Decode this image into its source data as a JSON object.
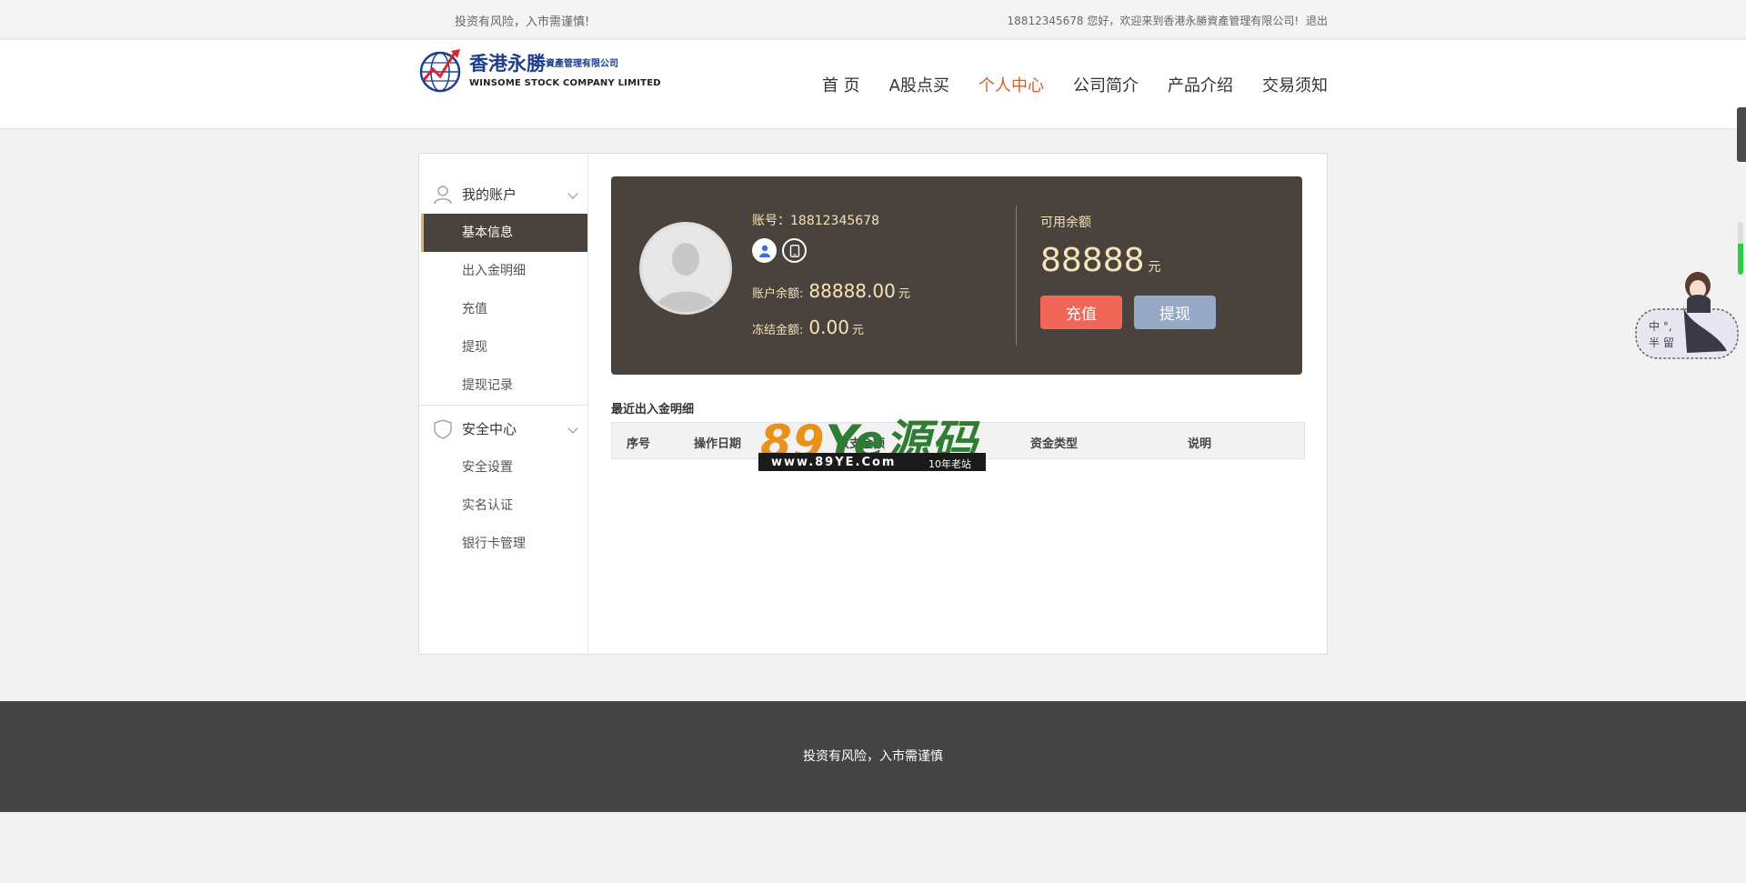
{
  "topbar": {
    "risk_text": "投资有风险，入市需谨慎!",
    "greeting": "18812345678 您好，欢迎来到香港永勝資產管理有限公司!",
    "logout": "退出"
  },
  "logo": {
    "name_cn": "香港永勝",
    "sub_cn": "資產管理有限公司",
    "name_en": "WINSOME STOCK COMPANY LIMITED",
    "icon": "globe-arrow-icon"
  },
  "nav": [
    {
      "label": "首 页",
      "active": false
    },
    {
      "label": "A股点买",
      "active": false
    },
    {
      "label": "个人中心",
      "active": true
    },
    {
      "label": "公司简介",
      "active": false
    },
    {
      "label": "产品介绍",
      "active": false
    },
    {
      "label": "交易须知",
      "active": false
    }
  ],
  "sidebar": {
    "account_section": {
      "title": "我的账户",
      "icon": "user-icon"
    },
    "account_items": [
      "基本信息",
      "出入金明细",
      "充值",
      "提现",
      "提现记录"
    ],
    "security_section": {
      "title": "安全中心",
      "icon": "shield-icon"
    },
    "security_items": [
      "安全设置",
      "实名认证",
      "银行卡管理"
    ]
  },
  "profile": {
    "account_label": "账号：",
    "account_value": "18812345678",
    "balance_label": "账户余额:",
    "balance_value": "88888.00",
    "frozen_label": "冻结金额:",
    "frozen_value": "0.00",
    "unit": "元",
    "available_label": "可用余额",
    "available_value": "88888",
    "recharge_btn": "充值",
    "withdraw_btn": "提现"
  },
  "recent": {
    "title": "最近出入金明细",
    "columns": [
      "序号",
      "操作日期",
      "收支金额",
      "资金类型",
      "说明"
    ]
  },
  "watermark": {
    "brand_num": "89",
    "brand_ye": "Ye",
    "brand_cn": "源码",
    "url": "www.89YE.Com",
    "tag": "10年老站"
  },
  "footer": {
    "text": "投资有风险，入市需谨慎"
  },
  "float_widget": {
    "text": "中 °, 半 留"
  },
  "colors": {
    "panel_bg": "#4a433d",
    "accent_gold": "#f1e2b8",
    "nav_active": "#c8632e",
    "recharge": "#f06757",
    "withdraw": "#96a9c4"
  }
}
